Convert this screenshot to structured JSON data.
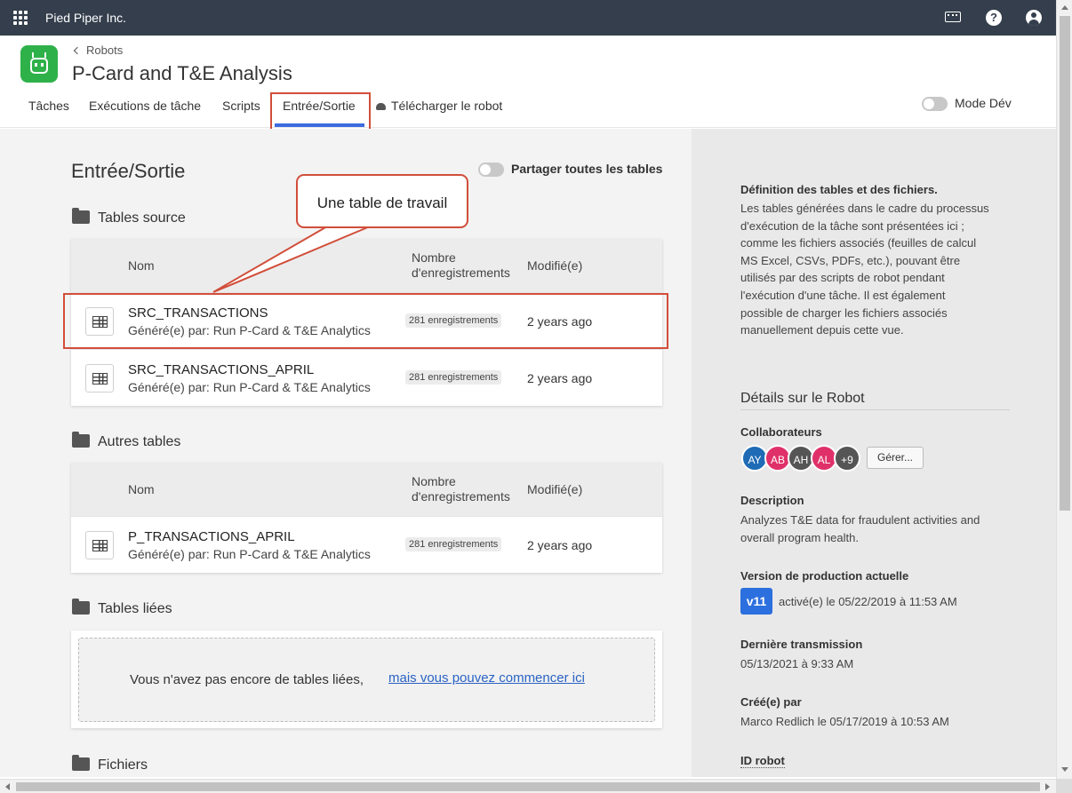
{
  "topbar": {
    "org_name": "Pied Piper Inc.",
    "icons": [
      "apps-grid-icon",
      "keyboard-icon",
      "help-icon",
      "user-account-icon"
    ]
  },
  "header": {
    "breadcrumb": "Robots",
    "title": "P-Card and T&E Analysis",
    "tabs": [
      {
        "label": "Tâches"
      },
      {
        "label": "Exécutions de tâche"
      },
      {
        "label": "Scripts"
      },
      {
        "label": "Entrée/Sortie",
        "active": true
      },
      {
        "label": "Télécharger le robot"
      }
    ],
    "mode_dev_label": "Mode Dév",
    "accent_color": "#3b6bde"
  },
  "main": {
    "title": "Entrée/Sortie",
    "share_label": "Partager toutes les tables",
    "callout": "Une table de travail",
    "columns": {
      "name": "Nom",
      "count_line1": "Nombre",
      "count_line2": "d'enregistrements",
      "modified": "Modifié(e)"
    },
    "source_tables": {
      "title": "Tables source",
      "rows": [
        {
          "name": "SRC_TRANSACTIONS",
          "generated_by": "Généré(e) par: Run P-Card & T&E Analytics",
          "count": "281 enregistrements",
          "modified": "2 years ago"
        },
        {
          "name": "SRC_TRANSACTIONS_APRIL",
          "generated_by": "Généré(e) par: Run P-Card & T&E Analytics",
          "count": "281 enregistrements",
          "modified": "2 years ago"
        }
      ]
    },
    "other_tables": {
      "title": "Autres tables",
      "rows": [
        {
          "name": "P_TRANSACTIONS_APRIL",
          "generated_by": "Généré(e) par: Run P-Card & T&E Analytics",
          "count": "281 enregistrements",
          "modified": "2 years ago"
        }
      ]
    },
    "linked_tables": {
      "title": "Tables liées",
      "empty_message": "Vous n'avez pas encore de tables liées,",
      "start_link": "mais vous pouvez commencer ici"
    },
    "files": {
      "title": "Fichiers"
    }
  },
  "side": {
    "definition_title": "Définition des tables et des fichiers.",
    "definition_lines": [
      "Les tables générées dans le cadre du processus",
      "d'exécution de la tâche sont présentées ici ;",
      "comme les fichiers associés (feuilles de calcul",
      "MS Excel, CSVs, PDFs, etc.), pouvant être",
      "utilisés par des scripts de robot pendant",
      "l'exécution d'une tâche. Il est également",
      "possible de charger les fichiers associés",
      "manuellement depuis cette vue."
    ],
    "details_title": "Détails sur le Robot",
    "collaborators_label": "Collaborateurs",
    "collaborators": [
      {
        "initials": "AY",
        "color": "#1f6bb5"
      },
      {
        "initials": "AB",
        "color": "#e0306a"
      },
      {
        "initials": "AH",
        "color": "#555555"
      },
      {
        "initials": "AL",
        "color": "#e0306a"
      },
      {
        "initials": "+9",
        "color": "#555555"
      }
    ],
    "manage_button": "Gérer...",
    "description_label": "Description",
    "description_lines": [
      "Analyzes T&E data for fraudulent activities and",
      "overall program health."
    ],
    "version_label": "Version de production actuelle",
    "version_badge": "v11",
    "version_text": "activé(e) le 05/22/2019 à 11:53 AM",
    "last_commit_label": "Dernière transmission",
    "last_commit_value": "05/13/2021 à 9:33 AM",
    "created_label": "Créé(e) par",
    "created_value": "Marco Redlich le 05/17/2019 à 10:53 AM",
    "robot_id_label": "ID robot"
  }
}
